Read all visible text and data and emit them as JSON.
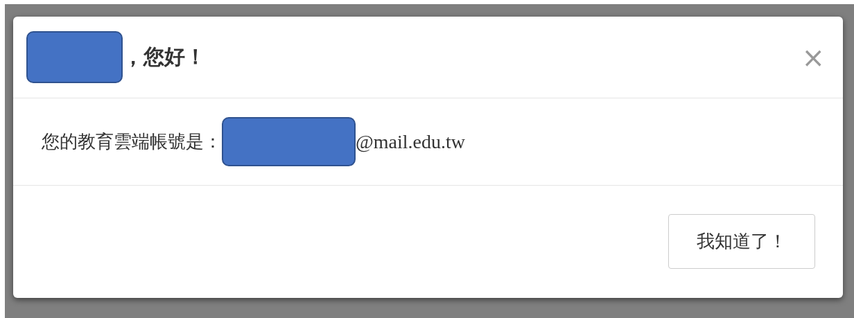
{
  "dialog": {
    "title": [
      {
        "kind": "redacted"
      },
      {
        "kind": "text",
        "text": "，您好！"
      }
    ],
    "close": "×",
    "body": [
      {
        "kind": "text",
        "text": "您的教育雲端帳號是："
      },
      {
        "kind": "redacted"
      },
      {
        "kind": "serif",
        "text": "@mail.edu.tw"
      }
    ],
    "buttons": [
      "我知道了！"
    ]
  }
}
